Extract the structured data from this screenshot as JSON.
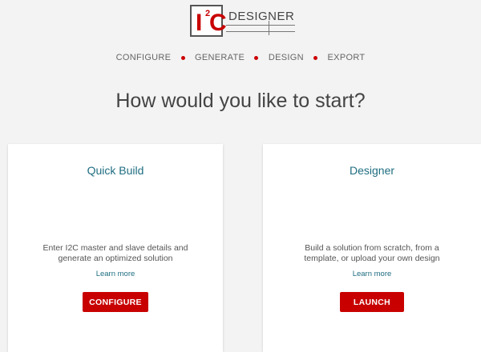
{
  "logo": {
    "i": "I",
    "sup": "2",
    "c": "C",
    "word": "DESIGNER"
  },
  "steps": [
    "CONFIGURE",
    "GENERATE",
    "DESIGN",
    "EXPORT"
  ],
  "headline": "How would you like to start?",
  "cards": [
    {
      "title": "Quick Build",
      "desc_line1": "Enter I2C master and slave details and",
      "desc_line2": "generate an optimized solution",
      "link": "Learn more",
      "button": "CONFIGURE"
    },
    {
      "title": "Designer",
      "desc_line1": "Build a solution from scratch, from a",
      "desc_line2": "template, or upload your own design",
      "link": "Learn more",
      "button": "LAUNCH"
    }
  ],
  "colors": {
    "accent": "#c80000",
    "title": "#1e6d80",
    "background": "#f3f3f3"
  }
}
